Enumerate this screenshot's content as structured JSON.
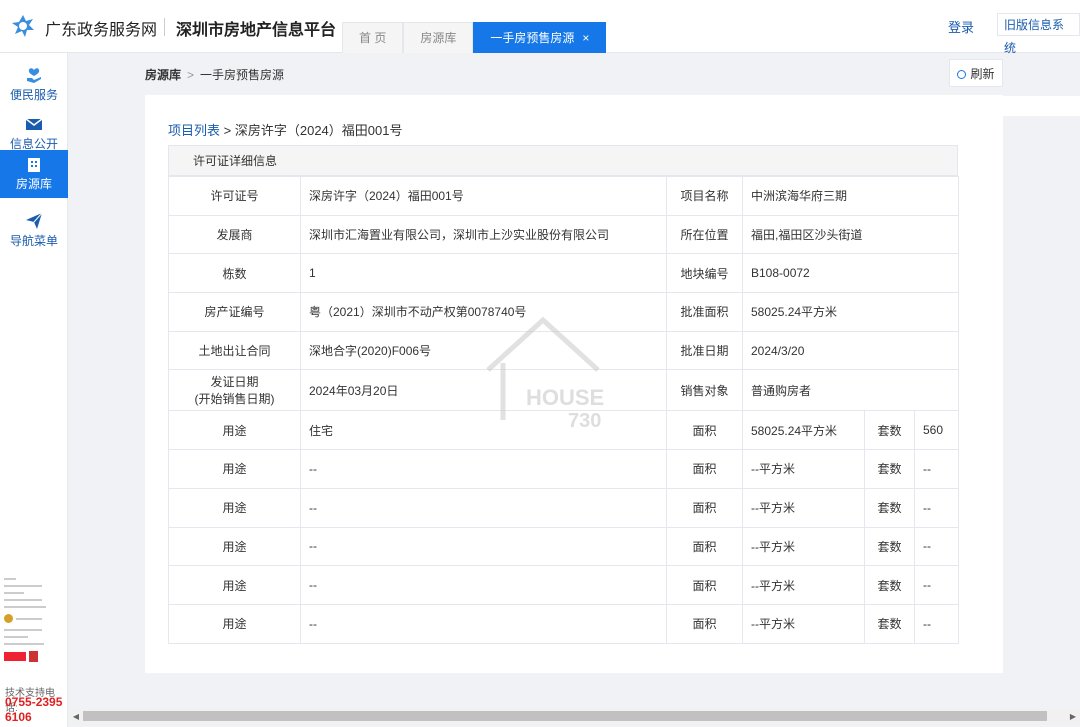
{
  "header": {
    "brand": "广东政务服务网",
    "platform": "深圳市房地产信息平台",
    "tabs": [
      {
        "label": "首 页",
        "active": false
      },
      {
        "label": "房源库",
        "active": false
      },
      {
        "label": "一手房预售房源",
        "active": true,
        "close": "×"
      }
    ],
    "login": "登录",
    "old_system": "旧版信息系统"
  },
  "sidebar": {
    "items": [
      {
        "label": "便民服务",
        "icon": "heart-hand-icon",
        "active": false
      },
      {
        "label": "信息公开",
        "icon": "mail-icon",
        "active": false
      },
      {
        "label": "房源库",
        "icon": "building-icon",
        "active": true
      },
      {
        "label": "导航菜单",
        "icon": "paper-plane-icon",
        "active": false
      }
    ],
    "support_label": "技术支持电话:",
    "support_phone": "0755-23956106"
  },
  "breadcrumb": {
    "root": "房源库",
    "sep": ">",
    "current": "一手房预售房源",
    "refresh": "刷新"
  },
  "detail": {
    "crumb_link": "项目列表",
    "crumb_sep": ">",
    "crumb_current": "深房许字（2024）福田001号",
    "section_title": "许可证详细信息",
    "rows": [
      {
        "l1": "许可证号",
        "v1": "深房许字（2024）福田001号",
        "l2": "项目名称",
        "v2": "中洲滨海华府三期"
      },
      {
        "l1": "发展商",
        "v1": "深圳市汇海置业有限公司，深圳市上沙实业股份有限公司",
        "l2": "所在位置",
        "v2": "福田,福田区沙头街道"
      },
      {
        "l1": "栋数",
        "v1": "1",
        "l2": "地块编号",
        "v2": "B108-0072"
      },
      {
        "l1": "房产证编号",
        "v1": "粤（2021）深圳市不动产权第0078740号",
        "l2": "批准面积",
        "v2": "58025.24平方米"
      },
      {
        "l1": "土地出让合同",
        "v1": "深地合字(2020)F006号",
        "l2": "批准日期",
        "v2": "2024/3/20"
      },
      {
        "l1a": "发证日期",
        "l1b": "(开始销售日期)",
        "v1": "2024年03月20日",
        "l2": "销售对象",
        "v2": "普通购房者"
      }
    ],
    "usage_rows": [
      {
        "l1": "用途",
        "v1": "住宅",
        "l2": "面积",
        "v2": "58025.24平方米",
        "l3": "套数",
        "v3": "560"
      },
      {
        "l1": "用途",
        "v1": "--",
        "l2": "面积",
        "v2": "--平方米",
        "l3": "套数",
        "v3": "--"
      },
      {
        "l1": "用途",
        "v1": "--",
        "l2": "面积",
        "v2": "--平方米",
        "l3": "套数",
        "v3": "--"
      },
      {
        "l1": "用途",
        "v1": "--",
        "l2": "面积",
        "v2": "--平方米",
        "l3": "套数",
        "v3": "--"
      },
      {
        "l1": "用途",
        "v1": "--",
        "l2": "面积",
        "v2": "--平方米",
        "l3": "套数",
        "v3": "--"
      },
      {
        "l1": "用途",
        "v1": "--",
        "l2": "面积",
        "v2": "--平方米",
        "l3": "套数",
        "v3": "--"
      }
    ]
  },
  "watermark": {
    "line1": "HOUSE",
    "line2": "730"
  },
  "colors": {
    "accent": "#1677e8",
    "link": "#1a5cad",
    "phone": "#e02020"
  }
}
